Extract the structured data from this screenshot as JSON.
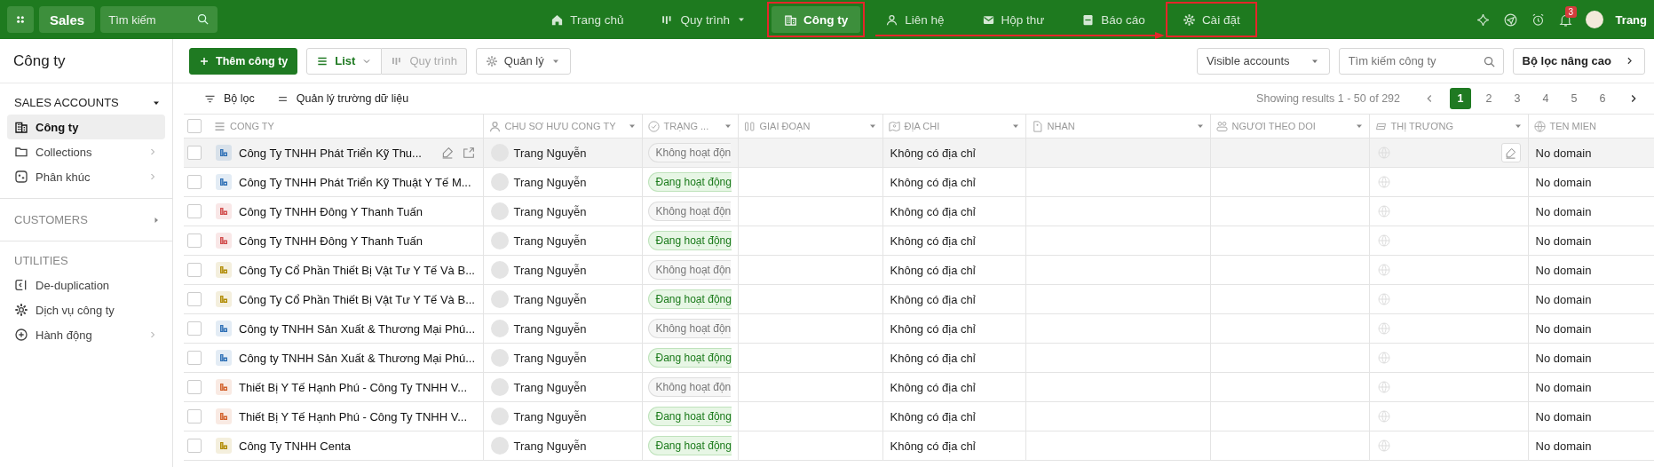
{
  "app": {
    "name": "Sales",
    "search_placeholder": "Tìm kiếm"
  },
  "nav": [
    {
      "label": "Trang chủ",
      "selected": false,
      "has_menu": false,
      "highlighted": false
    },
    {
      "label": "Quy trình",
      "selected": false,
      "has_menu": true,
      "highlighted": false
    },
    {
      "label": "Công ty",
      "selected": true,
      "has_menu": false,
      "highlighted": true
    },
    {
      "label": "Liên hệ",
      "selected": false,
      "has_menu": false,
      "highlighted": false
    },
    {
      "label": "Hộp thư",
      "selected": false,
      "has_menu": false,
      "highlighted": false
    },
    {
      "label": "Báo cáo",
      "selected": false,
      "has_menu": false,
      "highlighted": false
    },
    {
      "label": "Cài đặt",
      "selected": false,
      "has_menu": false,
      "highlighted": true
    }
  ],
  "annotation_arrow": true,
  "user": {
    "name": "Trang",
    "notifications": "3"
  },
  "sidebar": {
    "title": "Công ty",
    "sections": [
      {
        "kind": "group",
        "label": "SALES ACCOUNTS",
        "expanded": true,
        "items": [
          {
            "label": "Công ty",
            "selected": true,
            "has_submenu": false
          },
          {
            "label": "Collections",
            "selected": false,
            "has_submenu": true
          },
          {
            "label": "Phân khúc",
            "selected": false,
            "has_submenu": true
          }
        ]
      },
      {
        "kind": "group",
        "label": "CUSTOMERS",
        "expanded": false
      },
      {
        "kind": "label",
        "label": "UTILITIES",
        "items": [
          {
            "label": "De-duplication",
            "selected": false,
            "has_submenu": false
          },
          {
            "label": "Dịch vụ công ty",
            "selected": false,
            "has_submenu": false
          },
          {
            "label": "Hành động",
            "selected": false,
            "has_submenu": true
          }
        ]
      }
    ]
  },
  "toolbar": {
    "add_button": "Thêm công ty",
    "views": [
      {
        "label": "List",
        "selected": true,
        "has_menu": true
      },
      {
        "label": "Quy trình",
        "selected": false,
        "has_menu": false
      }
    ],
    "manage": "Quản lý",
    "visibility": "Visible accounts",
    "search_placeholder": "Tìm kiếm công ty",
    "advanced_filter": "Bộ lọc nâng cao"
  },
  "filterbar": {
    "filter": "Bộ lọc",
    "fields": "Quản lý trường dữ liệu",
    "results": "Showing results 1 - 50 of 292",
    "pages": [
      {
        "label": "1",
        "selected": true
      },
      {
        "label": "2",
        "selected": false
      },
      {
        "label": "3",
        "selected": false
      },
      {
        "label": "4",
        "selected": false
      },
      {
        "label": "5",
        "selected": false
      },
      {
        "label": "6",
        "selected": false
      }
    ]
  },
  "table": {
    "header_checked": false,
    "columns": [
      {
        "label": "CONG TY",
        "has_menu": false
      },
      {
        "label": "CHU SƠ HƯU CONG TY",
        "has_menu": true
      },
      {
        "label": "TRẠNG ...",
        "has_menu": true
      },
      {
        "label": "GIAI ĐOẠN",
        "has_menu": true
      },
      {
        "label": "ĐỊA CHI",
        "has_menu": true
      },
      {
        "label": "NHAN",
        "has_menu": true
      },
      {
        "label": "NGƯƠI THEO DOI",
        "has_menu": true
      },
      {
        "label": "THỊ TRƯƠNG",
        "has_menu": true
      },
      {
        "label": "TEN MIEN",
        "has_menu": false
      }
    ],
    "rows": [
      {
        "company": "Công Ty TNHH Phát Triển Kỹ Thu...",
        "color": "#2d6fb5",
        "checked": false,
        "hovered": true,
        "owner": "Trang Nguyễn",
        "status": {
          "kind": "inactive",
          "label": "Không hoạt độn"
        },
        "address": "Không có địa chỉ",
        "domain": "No domain"
      },
      {
        "company": "Công Ty TNHH Phát Triển Kỹ Thuật Y Tế M...",
        "color": "#2d6fb5",
        "checked": false,
        "hovered": false,
        "owner": "Trang Nguyễn",
        "status": {
          "kind": "active",
          "label": "Đang hoạt động"
        },
        "address": "Không có địa chỉ",
        "domain": "No domain"
      },
      {
        "company": "Công Ty TNHH Đông Y Thanh Tuấn",
        "color": "#d14b4b",
        "checked": false,
        "hovered": false,
        "owner": "Trang Nguyễn",
        "status": {
          "kind": "inactive",
          "label": "Không hoạt độn"
        },
        "address": "Không có địa chỉ",
        "domain": "No domain"
      },
      {
        "company": "Công Ty TNHH Đông Y Thanh Tuấn",
        "color": "#d14b4b",
        "checked": false,
        "hovered": false,
        "owner": "Trang Nguyễn",
        "status": {
          "kind": "active",
          "label": "Đang hoạt động"
        },
        "address": "Không có địa chỉ",
        "domain": "No domain"
      },
      {
        "company": "Công Ty Cổ Phần Thiết Bị Vật Tư Y Tế Và B...",
        "color": "#b08a00",
        "checked": false,
        "hovered": false,
        "owner": "Trang Nguyễn",
        "status": {
          "kind": "inactive",
          "label": "Không hoạt độn"
        },
        "address": "Không có địa chỉ",
        "domain": "No domain"
      },
      {
        "company": "Công Ty Cổ Phần Thiết Bị Vật Tư Y Tế Và B...",
        "color": "#b08a00",
        "checked": false,
        "hovered": false,
        "owner": "Trang Nguyễn",
        "status": {
          "kind": "active",
          "label": "Đang hoạt động"
        },
        "address": "Không có địa chỉ",
        "domain": "No domain"
      },
      {
        "company": "Công ty TNHH Sản Xuất & Thương Mại Phú...",
        "color": "#2d6fb5",
        "checked": false,
        "hovered": false,
        "owner": "Trang Nguyễn",
        "status": {
          "kind": "inactive",
          "label": "Không hoạt độn"
        },
        "address": "Không có địa chỉ",
        "domain": "No domain"
      },
      {
        "company": "Công ty TNHH Sản Xuất & Thương Mại Phú...",
        "color": "#2d6fb5",
        "checked": false,
        "hovered": false,
        "owner": "Trang Nguyễn",
        "status": {
          "kind": "active",
          "label": "Đang hoạt động"
        },
        "address": "Không có địa chỉ",
        "domain": "No domain"
      },
      {
        "company": "Thiết Bị Y Tế Hạnh Phú - Công Ty TNHH V...",
        "color": "#d2602a",
        "checked": false,
        "hovered": false,
        "owner": "Trang Nguyễn",
        "status": {
          "kind": "inactive",
          "label": "Không hoạt độn"
        },
        "address": "Không có địa chỉ",
        "domain": "No domain"
      },
      {
        "company": "Thiết Bị Y Tế Hạnh Phú - Công Ty TNHH V...",
        "color": "#d2602a",
        "checked": false,
        "hovered": false,
        "owner": "Trang Nguyễn",
        "status": {
          "kind": "active",
          "label": "Đang hoạt động"
        },
        "address": "Không có địa chỉ",
        "domain": "No domain"
      },
      {
        "company": "Công Ty TNHH Centa",
        "color": "#b08a00",
        "checked": false,
        "hovered": false,
        "owner": "Trang Nguyễn",
        "status": {
          "kind": "active",
          "label": "Đang hoạt động"
        },
        "address": "Không có địa chỉ",
        "domain": "No domain"
      }
    ]
  }
}
